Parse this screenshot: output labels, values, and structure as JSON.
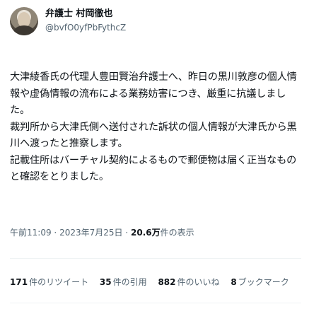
{
  "author": {
    "display_name": "弁護士 村岡徹也",
    "handle": "@bvfO0yfPbFythcZ"
  },
  "tweet": {
    "paragraphs": [
      "大津綾香氏の代理人豊田賢治弁護士へ、昨日の黒川敦彦の個人情報や虚偽情報の流布による業務妨害につき、厳重に抗議しました。",
      "裁判所から大津氏側へ送付された訴状の個人情報が大津氏から黒川へ渡ったと推察します。",
      "記載住所はバーチャル契約によるもので郵便物は届く正当なものと確認をとりました。"
    ]
  },
  "meta": {
    "time": "午前11:09",
    "dot1": "·",
    "date": "2023年7月25日",
    "dot2": "·",
    "views_count": "20.6万",
    "views_label": "件の表示"
  },
  "stats": {
    "retweets_count": "171",
    "retweets_label": "件のリツイート",
    "quotes_count": "35",
    "quotes_label": "件の引用",
    "likes_count": "882",
    "likes_label": "件のいいね",
    "bookmarks_count": "8",
    "bookmarks_label": "ブックマーク"
  }
}
